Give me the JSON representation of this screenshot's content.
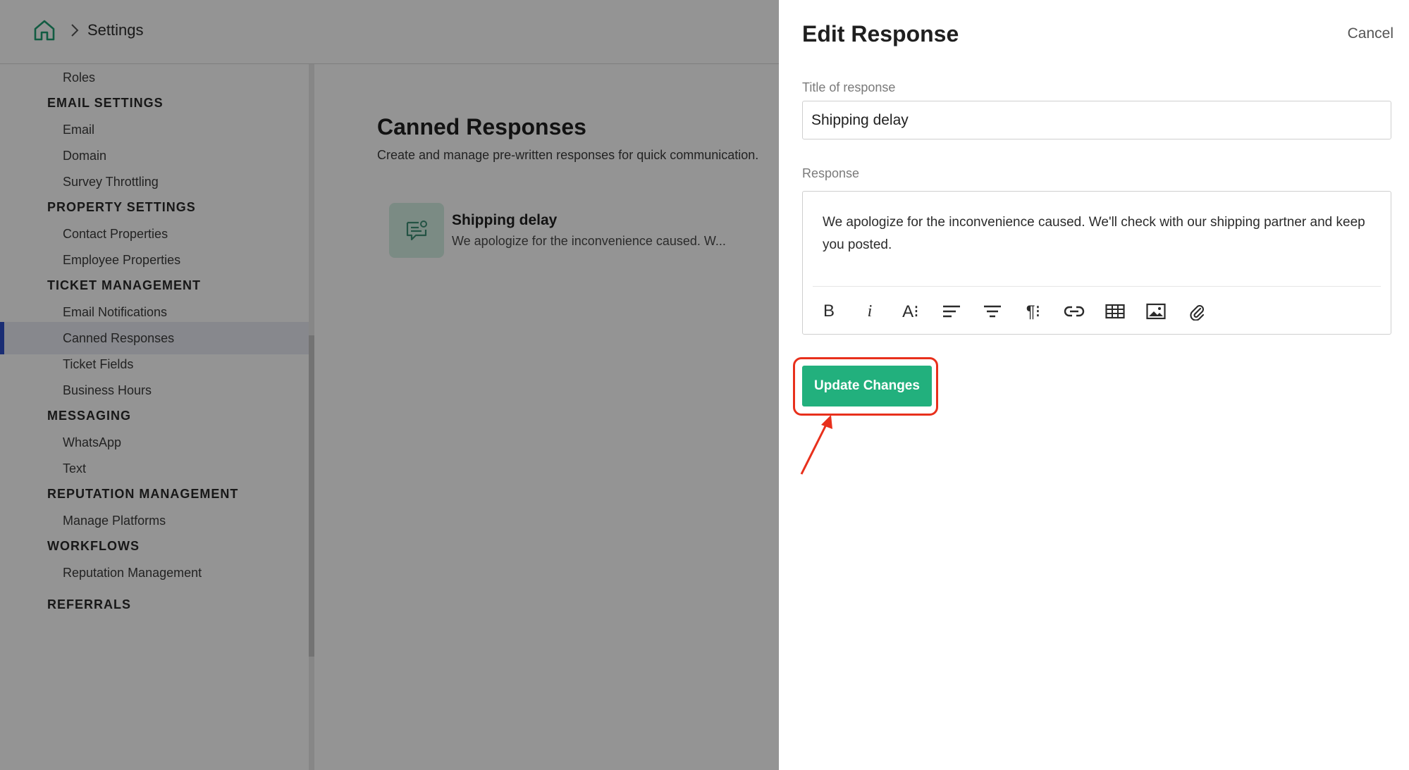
{
  "breadcrumb": {
    "current": "Settings"
  },
  "sidebar": {
    "sections": [
      {
        "header": "",
        "items": [
          {
            "label": "Roles"
          }
        ]
      },
      {
        "header": "EMAIL SETTINGS",
        "items": [
          {
            "label": "Email"
          },
          {
            "label": "Domain"
          },
          {
            "label": "Survey Throttling"
          }
        ]
      },
      {
        "header": "PROPERTY SETTINGS",
        "items": [
          {
            "label": "Contact Properties"
          },
          {
            "label": "Employee Properties"
          }
        ]
      },
      {
        "header": "TICKET MANAGEMENT",
        "items": [
          {
            "label": "Email Notifications"
          },
          {
            "label": "Canned Responses",
            "active": true
          },
          {
            "label": "Ticket Fields"
          },
          {
            "label": "Business Hours"
          }
        ]
      },
      {
        "header": "MESSAGING",
        "items": [
          {
            "label": "WhatsApp"
          },
          {
            "label": "Text"
          }
        ]
      },
      {
        "header": "REPUTATION MANAGEMENT",
        "items": [
          {
            "label": "Manage Platforms"
          }
        ]
      },
      {
        "header": "WORKFLOWS",
        "items": [
          {
            "label": "Reputation Management"
          }
        ]
      },
      {
        "header": "REFERRALS",
        "items": []
      }
    ]
  },
  "main": {
    "title": "Canned Responses",
    "subtitle": "Create and manage pre-written responses for quick communication.",
    "responses": [
      {
        "title": "Shipping delay",
        "preview": "We apologize for the inconvenience caused. W..."
      }
    ]
  },
  "drawer": {
    "title": "Edit Response",
    "cancel_label": "Cancel",
    "title_field_label": "Title of response",
    "title_value": "Shipping delay",
    "response_field_label": "Response",
    "response_text": "We apologize for the inconvenience caused. We'll check with our shipping partner and keep you posted.",
    "toolbar": [
      {
        "icon": "bold-icon",
        "glyph": "B"
      },
      {
        "icon": "italic-icon",
        "glyph": "i"
      },
      {
        "icon": "font-size-icon",
        "glyph": "A⁝"
      },
      {
        "icon": "align-left-icon"
      },
      {
        "icon": "align-center-icon"
      },
      {
        "icon": "paragraph-icon",
        "glyph": "¶⁝"
      },
      {
        "icon": "link-icon"
      },
      {
        "icon": "table-icon"
      },
      {
        "icon": "image-icon"
      },
      {
        "icon": "attachment-icon"
      }
    ],
    "submit_label": "Update Changes"
  },
  "colors": {
    "accent_green": "#22b07d",
    "highlight_red": "#e8301c",
    "active_nav_bar": "#2d4ec8"
  }
}
